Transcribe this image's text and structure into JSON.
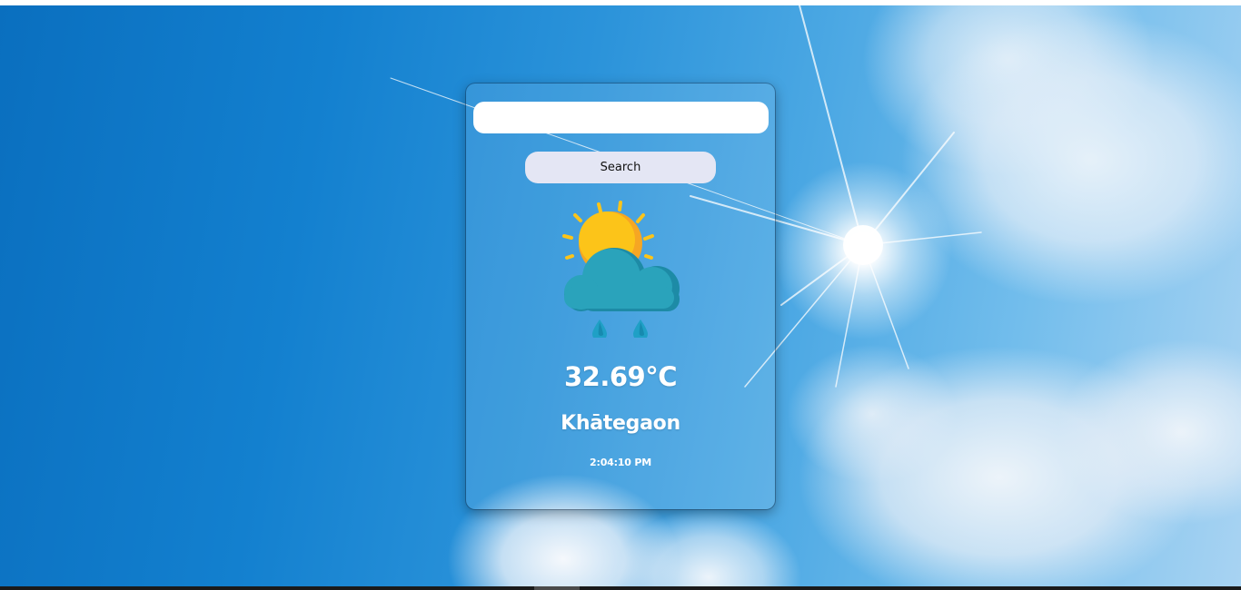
{
  "search": {
    "input_value": "",
    "input_placeholder": "",
    "button_label": "Search"
  },
  "weather": {
    "icon": "partly-cloudy-rain-icon",
    "temperature": "32.69°C",
    "city": "Khātegaon",
    "time": "2:04:10 PM"
  },
  "colors": {
    "sky_blue": "#1380cf",
    "button_bg": "#e4e6f4",
    "sun_yellow": "#fcc419",
    "sun_orange": "#f6a623",
    "cloud_teal": "#2aa3bb",
    "cloud_shadow": "#1d8ba6",
    "rain_drop": "#1fa0c6"
  }
}
